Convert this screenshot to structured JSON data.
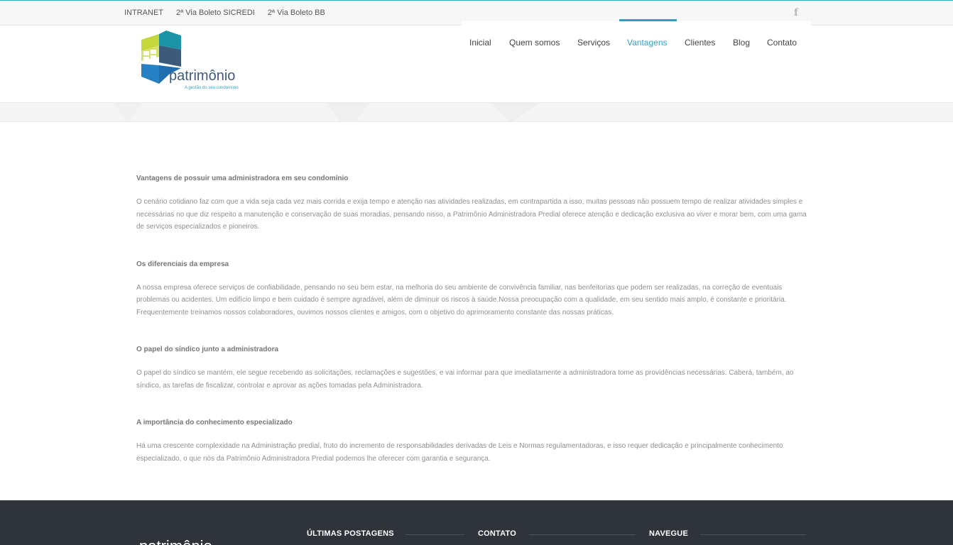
{
  "topbar": {
    "links": [
      "INTRANET",
      "2ª Via Boleto SICREDI",
      "2ª Via Boleto BB"
    ],
    "facebook_icon": "facebook-icon",
    "facebook_glyph": "f"
  },
  "logo": {
    "name": "patrimônio",
    "tagline": "A gestão do seu condomínio",
    "colors": {
      "lime": "#c5d73a",
      "teal": "#1b94a8",
      "navy": "#3d5a7a",
      "blue": "#2680c2"
    }
  },
  "nav": {
    "items": [
      "Inicial",
      "Quem somos",
      "Serviços",
      "Vantagens",
      "Clientes",
      "Blog",
      "Contato"
    ],
    "active": "Vantagens"
  },
  "content": {
    "sections": [
      {
        "title": "Vantagens de possuir uma administradora em seu condomínio",
        "body": "O cenário cotidiano faz com que a vida seja cada vez mais corrida e exija tempo e atenção nas atividades realizadas, em contrapartida a isso, muitas pessoas não possuem tempo de realizar atividades simples e necessárias no que diz respeito a manutenção e conservação de suas moradias, pensando nisso, a Patrimônio Administradora Predial oferece atenção e dedicação exclusiva ao viver e morar bem, com uma gama de serviços especializados e pioneiros."
      },
      {
        "title": "Os diferenciais da empresa",
        "body": "A nossa empresa oferece serviços de confiabilidade, pensando no seu bem estar, na melhoria do seu ambiente de convivência familiar, nas benfeitorias que podem ser realizadas, na correção de eventuais problemas ou acidentes. Um edifício limpo e bem cuidado é sempre agradável, além de diminuir os riscos à saúde.Nossa preocupação com a qualidade, em seu sentido mais amplo, é constante e prioritária. Frequentemente treinamos nossos colaboradores, ouvimos nossos clientes e amigos, com o objetivo do aprimoramento constante das nossas práticas."
      },
      {
        "title": "O papel do síndico junto a administradora",
        "body": "O papel do síndico se mantém, ele segue recebendo as solicitações, reclamações e sugestões, e vai informar para que imediatamente a administradora tome as providências necessárias. Caberá, também, ao síndico, as tarefas de fiscalizar, controlar e aprovar as ações tomadas pela Administradora."
      },
      {
        "title": "A importância do conhecimento especializado",
        "body": "Há uma crescente complexidade na Administração predial, fruto do incremento de responsabilidades derivadas de Leis e Normas regulamentadoras, e isso requer dedicação e principalmente conhecimento especializado, o que nós da Patrimônio Administradora Predial podemos lhe oferecer com garantia e segurança."
      }
    ]
  },
  "footer": {
    "logo_text": "patrimônio",
    "columns": [
      "ÚLTIMAS POSTAGENS",
      "CONTATO",
      "NAVEGUE"
    ]
  }
}
